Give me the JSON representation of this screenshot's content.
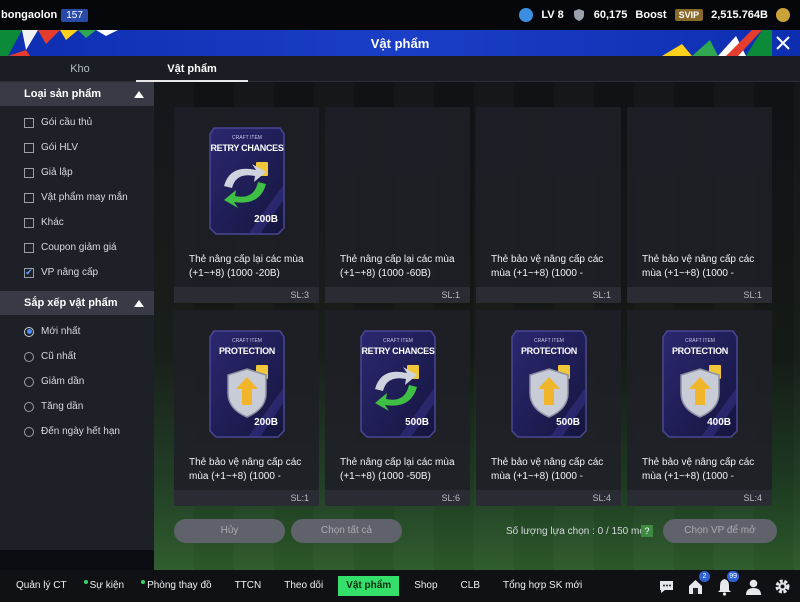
{
  "topbar": {
    "username": "bongaolon",
    "user_badge": "157",
    "level": "LV 8",
    "points": "60,175",
    "boost_label": "Boost",
    "svip_label": "SVIP",
    "balance": "2,515.764B"
  },
  "window": {
    "title": "Vật phẩm"
  },
  "tabs": [
    {
      "label": "Kho"
    },
    {
      "label": "Vật phẩm"
    }
  ],
  "sidebar": {
    "product_type_title": "Loại sản phẩm",
    "product_filters": [
      {
        "label": "Gói cầu thủ",
        "checked": false
      },
      {
        "label": "Gói HLV",
        "checked": false
      },
      {
        "label": "Giả lập",
        "checked": false
      },
      {
        "label": "Vật phẩm may mắn",
        "checked": false
      },
      {
        "label": "Khác",
        "checked": false
      },
      {
        "label": "Coupon giảm giá",
        "checked": false
      },
      {
        "label": "VP nâng cấp",
        "checked": true
      }
    ],
    "sort_title": "Sắp xếp vật phẩm",
    "sort_options": [
      {
        "label": "Mới nhất",
        "selected": true
      },
      {
        "label": "Cũ nhất",
        "selected": false
      },
      {
        "label": "Giảm dần",
        "selected": false
      },
      {
        "label": "Tăng dần",
        "selected": false
      },
      {
        "label": "Đến ngày hết hạn",
        "selected": false
      }
    ]
  },
  "items": [
    {
      "art_type": "RETRY CHANCES",
      "art_sub": "CRAFT ITEM",
      "art_price": "200B",
      "name": "Thẻ nâng cấp lại các mùa (+1~+8) (1000 -20B)",
      "qty": "SL:3",
      "kind": "retry"
    },
    {
      "art_type": "",
      "art_sub": "",
      "art_price": "",
      "name": "Thẻ nâng cấp lại các mùa (+1~+8) (1000 -60B)",
      "qty": "SL:1",
      "kind": "none"
    },
    {
      "art_type": "",
      "art_sub": "",
      "art_price": "",
      "name": "Thẻ bảo vệ nâng cấp các mùa (+1~+8) (1000 -",
      "qty": "SL:1",
      "kind": "none"
    },
    {
      "art_type": "",
      "art_sub": "",
      "art_price": "",
      "name": "Thẻ bảo vệ nâng cấp các mùa (+1~+8) (1000 -",
      "qty": "SL:1",
      "kind": "none"
    },
    {
      "art_type": "PROTECTION",
      "art_sub": "CRAFT ITEM",
      "art_price": "200B",
      "name": "Thẻ bảo vệ nâng cấp các mùa (+1~+8) (1000 -",
      "qty": "SL:1",
      "kind": "protection"
    },
    {
      "art_type": "RETRY CHANCES",
      "art_sub": "CRAFT ITEM",
      "art_price": "500B",
      "name": "Thẻ nâng cấp lại các mùa (+1~+8) (1000 -50B)",
      "qty": "SL:6",
      "kind": "retry"
    },
    {
      "art_type": "PROTECTION",
      "art_sub": "CRAFT ITEM",
      "art_price": "500B",
      "name": "Thẻ bảo vệ nâng cấp các mùa (+1~+8) (1000 -",
      "qty": "SL:4",
      "kind": "protection"
    },
    {
      "art_type": "PROTECTION",
      "art_sub": "CRAFT ITEM",
      "art_price": "400B",
      "name": "Thẻ bảo vệ nâng cấp các mùa (+1~+8) (1000 -",
      "qty": "SL:4",
      "kind": "protection"
    }
  ],
  "actions": {
    "cancel_label": "Hủy",
    "select_all_label": "Chọn tất cả",
    "selection_count": "Số lượng lựa chọn : 0 / 150 món",
    "help_label": "?",
    "choose_label": "Chọn VP để mở"
  },
  "bottom_nav": [
    {
      "label": "Quản lý CT",
      "dot": false,
      "active": false
    },
    {
      "label": "Sự kiện",
      "dot": true,
      "active": false
    },
    {
      "label": "Phòng thay đồ",
      "dot": true,
      "active": false
    },
    {
      "label": "TTCN",
      "dot": false,
      "active": false
    },
    {
      "label": "Theo dõi",
      "dot": false,
      "active": false
    },
    {
      "label": "Vật phẩm",
      "dot": false,
      "active": true
    },
    {
      "label": "Shop",
      "dot": false,
      "active": false
    },
    {
      "label": "CLB",
      "dot": false,
      "active": false
    },
    {
      "label": "Tổng hợp SK mới",
      "dot": false,
      "active": false
    }
  ],
  "nav_icons": [
    {
      "icon": "chat-icon",
      "badge": ""
    },
    {
      "icon": "mailbox-icon",
      "badge": "2"
    },
    {
      "icon": "bell-icon",
      "badge": "99"
    },
    {
      "icon": "profile-icon",
      "badge": ""
    },
    {
      "icon": "settings-gear-icon",
      "badge": ""
    }
  ],
  "colors": {
    "title_bar": "#1a3ec6",
    "active_nav": "#35e06a",
    "card_bg": "#1e2027"
  }
}
